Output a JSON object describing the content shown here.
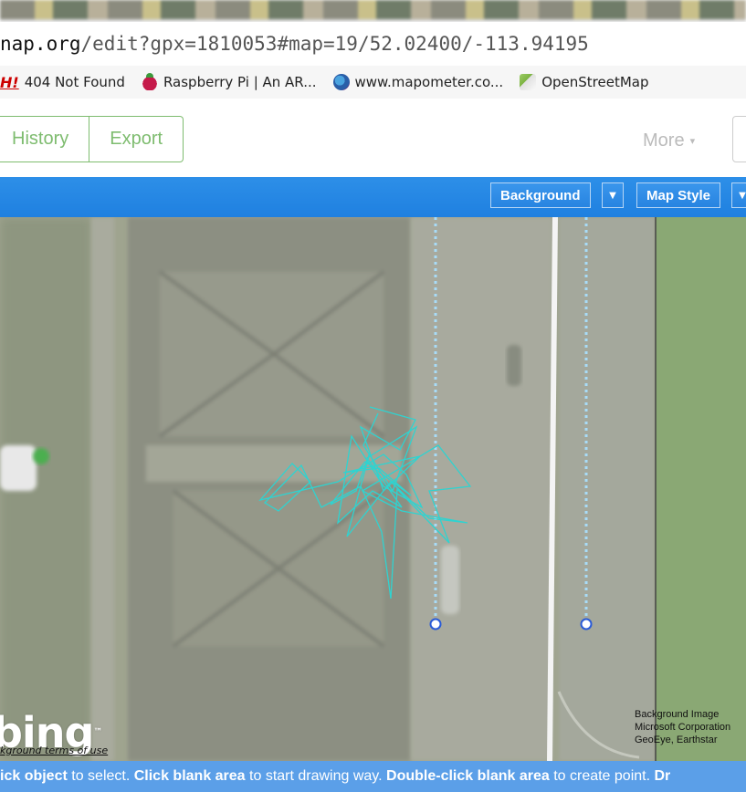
{
  "browser": {
    "address": {
      "host": "nap.org",
      "path": "/edit?gpx=1810053#map=19/52.02400/-113.94195"
    },
    "bookmarks": [
      {
        "icon": "hi-icon",
        "icon_text": "H!",
        "label": "404 Not Found"
      },
      {
        "icon": "raspberry-pi-icon",
        "label": "Raspberry Pi | An AR..."
      },
      {
        "icon": "globe-icon",
        "label": "www.mapometer.co..."
      },
      {
        "icon": "openstreetmap-icon",
        "label": "OpenStreetMap"
      }
    ]
  },
  "toolbar": {
    "history_label": "History",
    "export_label": "Export",
    "more_label": "More",
    "more_caret": "▾"
  },
  "map_controls": {
    "background_label": "Background",
    "map_style_label": "Map Style",
    "caret": "▼"
  },
  "map": {
    "bing_logo": "bing",
    "bing_tm": "™",
    "bing_terms": "kground terms of use",
    "attribution_lines": [
      "Background Image",
      "Microsoft Corporation",
      "GeoEye, Earthstar"
    ],
    "colors": {
      "gpx_track": "#2fd3d0",
      "node": "#2a5bd7",
      "road": "#f4f4f4"
    }
  },
  "footer": {
    "p1_bold": "ick object",
    "p1": " to select. ",
    "p2_bold": "Click blank area",
    "p2": " to start drawing way. ",
    "p3_bold": "Double-click blank area",
    "p3": " to create point. ",
    "p4_bold": "Dr"
  }
}
